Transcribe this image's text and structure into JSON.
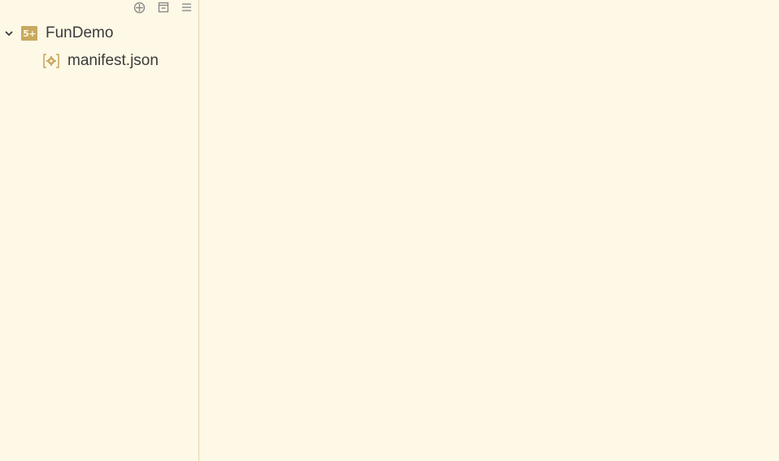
{
  "toolbar": {
    "buttons": [
      {
        "icon": "crosshair-icon"
      },
      {
        "icon": "collapse-all-icon"
      },
      {
        "icon": "menu-icon"
      }
    ]
  },
  "tree": {
    "project": {
      "label": "FunDemo",
      "icon_text": "5+",
      "expanded": true
    },
    "files": [
      {
        "label": "manifest.json",
        "icon": "settings-file-icon"
      }
    ]
  },
  "colors": {
    "background": "#fef8e6",
    "accent": "#c8a95f",
    "divider": "#e3d6a8",
    "text": "#3b3b3b"
  }
}
